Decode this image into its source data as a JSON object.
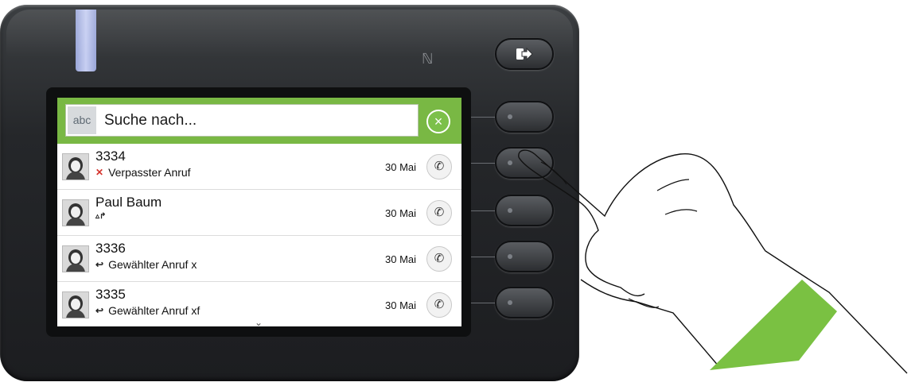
{
  "search": {
    "abc_label": "abc",
    "placeholder": "Suche nach...",
    "clear_icon": "×"
  },
  "calls": [
    {
      "name": "3334",
      "status": "Verpasster Anruf",
      "icon": "missed-call-icon",
      "icon_glyph": "✕",
      "date": "30 Mai"
    },
    {
      "name": "Paul Baum",
      "status": "",
      "icon": "forwarded-call-icon",
      "icon_glyph": "▵↱",
      "date": "30 Mai"
    },
    {
      "name": "3336",
      "status": "Gewählter Anruf x",
      "icon": "dialed-call-icon",
      "icon_glyph": "↩",
      "date": "30 Mai"
    },
    {
      "name": "3335",
      "status": "Gewählter Anruf xf",
      "icon": "dialed-call-icon",
      "icon_glyph": "↩",
      "date": "30 Mai"
    }
  ],
  "dial_glyph": "✆",
  "more_glyph": "⌄",
  "colors": {
    "accent_green": "#79b844",
    "missed_red": "#d4322c",
    "wristband_green": "#7ac142"
  }
}
